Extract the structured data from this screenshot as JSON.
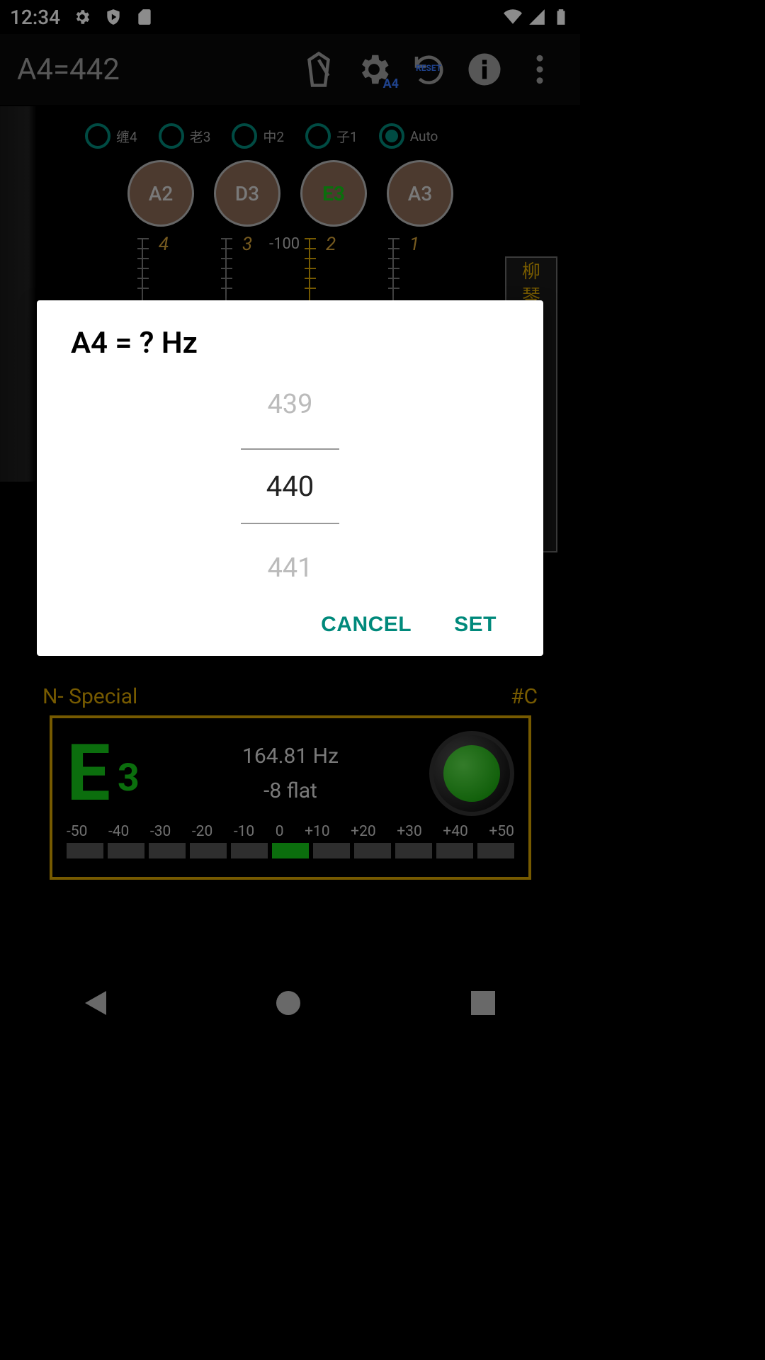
{
  "status": {
    "time": "12:34"
  },
  "appbar": {
    "title": "A4=442",
    "settings_sub": "A4",
    "reset_label": "RESET"
  },
  "radios": [
    {
      "label": "缠4",
      "checked": false
    },
    {
      "label": "老3",
      "checked": false
    },
    {
      "label": "中2",
      "checked": false
    },
    {
      "label": "子1",
      "checked": false
    },
    {
      "label": "Auto",
      "checked": true
    }
  ],
  "notes": [
    {
      "label": "A2",
      "active": false
    },
    {
      "label": "D3",
      "active": false
    },
    {
      "label": "E3",
      "active": true
    },
    {
      "label": "A3",
      "active": false
    }
  ],
  "scale_numbers": [
    "4",
    "3",
    "2",
    "1"
  ],
  "cents_label": "-100",
  "side_panel": {
    "line1": "柳",
    "line2": "琴"
  },
  "bottom_row": {
    "left": "N- Special",
    "right": "#C"
  },
  "tuner": {
    "note_letter": "E",
    "note_octave": "3",
    "freq": "164.81 Hz",
    "offset": "-8 flat",
    "meter_labels": [
      "-50",
      "-40",
      "-30",
      "-20",
      "-10",
      "0",
      "+10",
      "+20",
      "+30",
      "+40",
      "+50"
    ],
    "meter_active_index": 5
  },
  "dialog": {
    "title": "A4 = ? Hz",
    "prev": "439",
    "current": "440",
    "next": "441",
    "cancel": "CANCEL",
    "set": "SET"
  }
}
